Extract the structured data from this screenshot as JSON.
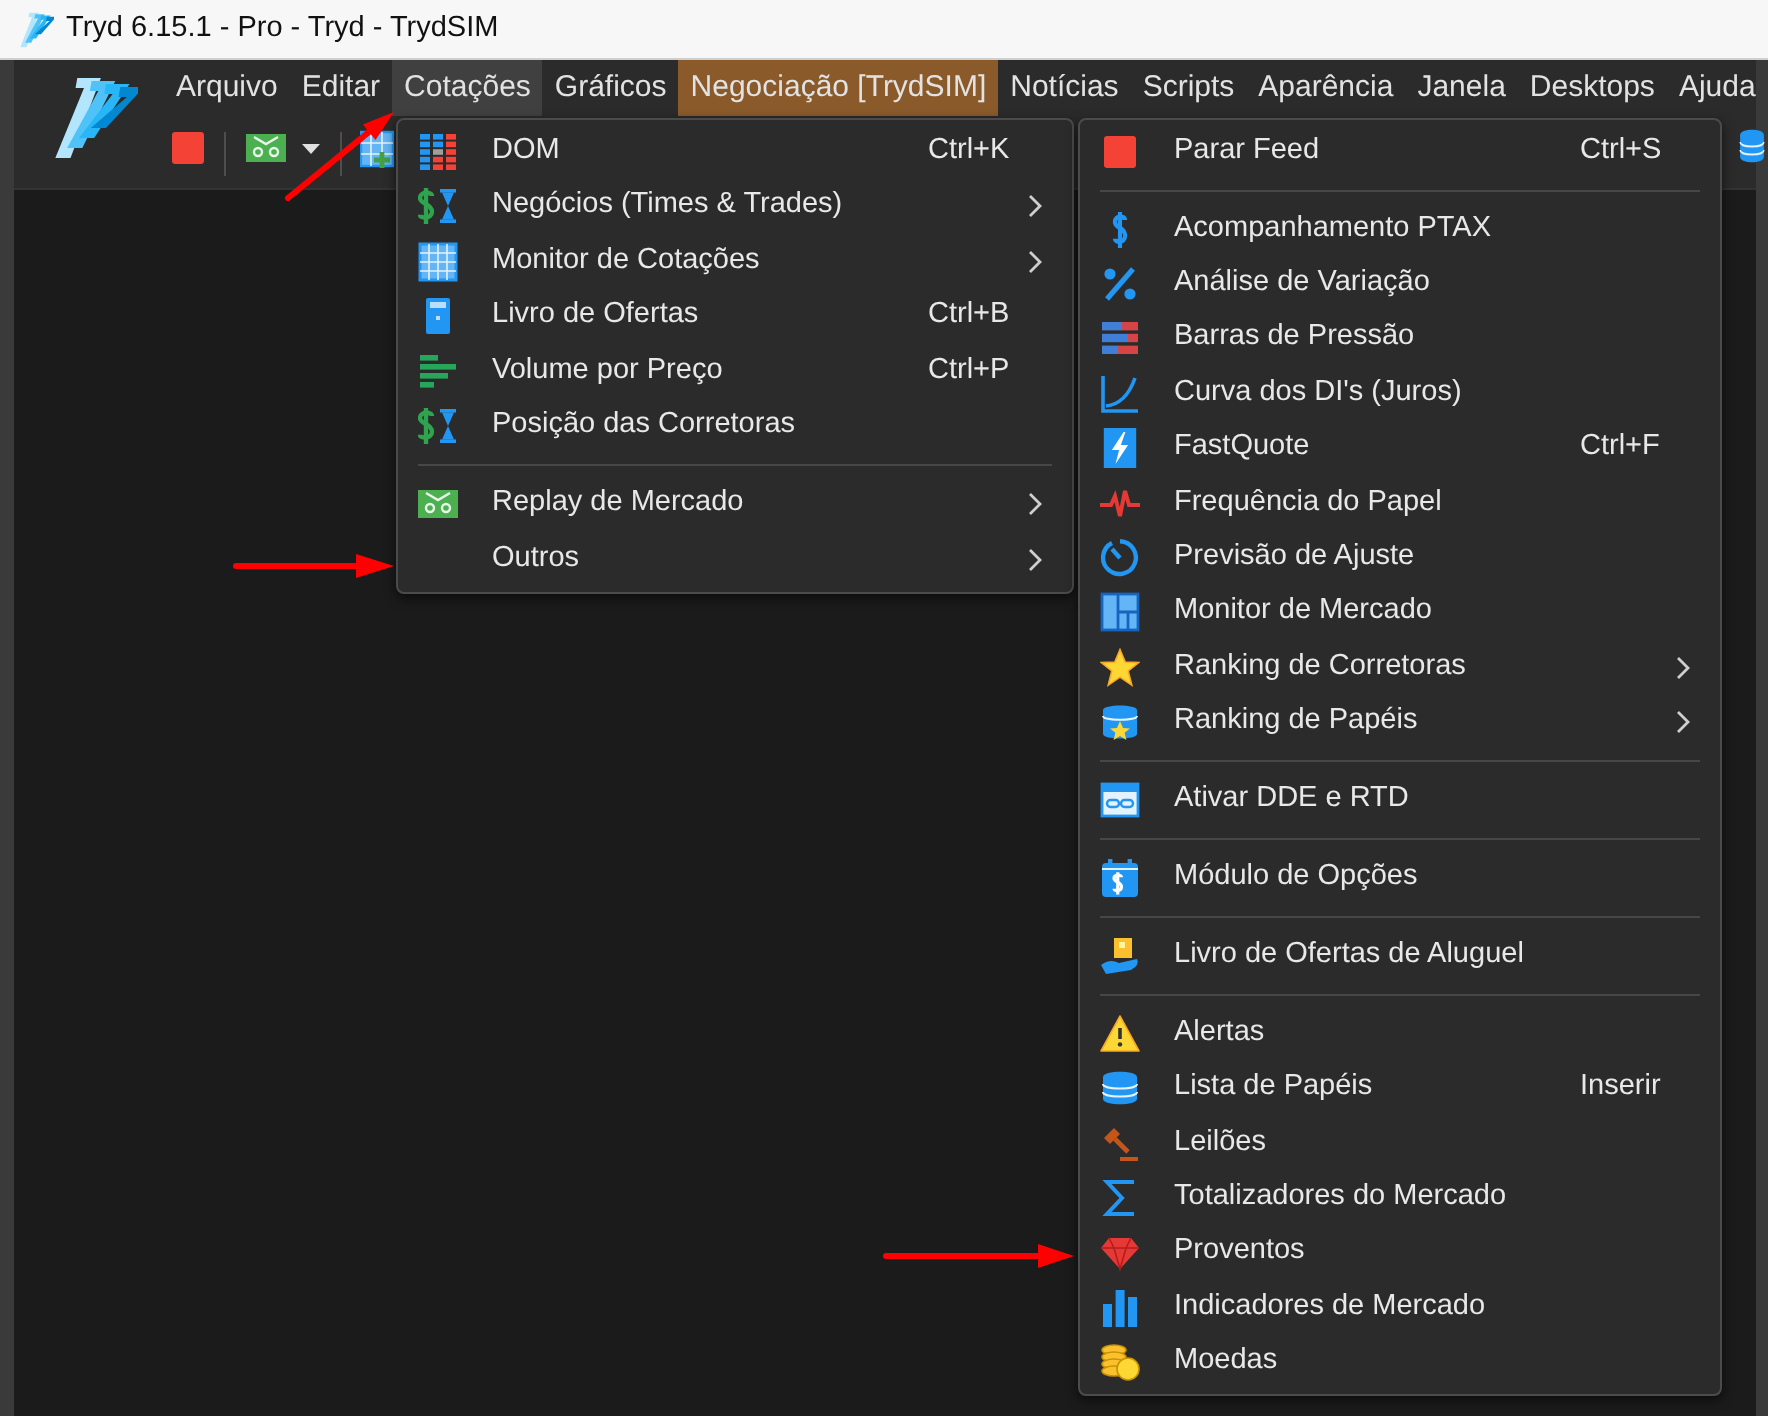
{
  "window": {
    "title": "Tryd 6.15.1 - Pro - Tryd - TrydSIM"
  },
  "menubar": [
    {
      "label": "Arquivo",
      "selected": false
    },
    {
      "label": "Editar",
      "selected": false
    },
    {
      "label": "Cotações",
      "selected": true
    },
    {
      "label": "Gráficos",
      "selected": false
    },
    {
      "label": "Negociação [TrydSIM]",
      "selected": false,
      "color": "#8a5a2b"
    },
    {
      "label": "Notícias",
      "selected": false
    },
    {
      "label": "Scripts",
      "selected": false
    },
    {
      "label": "Aparência",
      "selected": false
    },
    {
      "label": "Janela",
      "selected": false
    },
    {
      "label": "Desktops",
      "selected": false
    },
    {
      "label": "Ajuda",
      "selected": false
    }
  ],
  "cotacoes_menu": {
    "groups": [
      {
        "items": [
          {
            "label": "DOM",
            "shortcut": "Ctrl+K",
            "submenu": false
          },
          {
            "label": "Negócios (Times & Trades)",
            "submenu": true
          },
          {
            "label": "Monitor de Cotações",
            "submenu": true
          },
          {
            "label": "Livro de Ofertas",
            "shortcut": "Ctrl+B",
            "submenu": false
          },
          {
            "label": "Volume por Preço",
            "shortcut": "Ctrl+P",
            "submenu": false
          },
          {
            "label": "Posição das Corretoras",
            "submenu": false
          }
        ]
      },
      {
        "items": [
          {
            "label": "Replay de Mercado",
            "submenu": true
          },
          {
            "label": "Outros",
            "submenu": true
          }
        ]
      }
    ]
  },
  "outros_submenu": {
    "groups": [
      {
        "items": [
          {
            "label": "Parar Feed",
            "shortcut": "Ctrl+S",
            "submenu": false
          }
        ]
      },
      {
        "items": [
          {
            "label": "Acompanhamento PTAX",
            "submenu": false
          },
          {
            "label": "Análise de Variação",
            "submenu": false
          },
          {
            "label": "Barras de Pressão",
            "submenu": false
          },
          {
            "label": "Curva dos DI's (Juros)",
            "submenu": false
          },
          {
            "label": "FastQuote",
            "shortcut": "Ctrl+F",
            "submenu": false
          },
          {
            "label": "Frequência do Papel",
            "submenu": false
          },
          {
            "label": "Previsão de Ajuste",
            "submenu": false
          },
          {
            "label": "Monitor de Mercado",
            "submenu": false
          },
          {
            "label": "Ranking de Corretoras",
            "submenu": true
          },
          {
            "label": "Ranking de Papéis",
            "submenu": true
          }
        ]
      },
      {
        "items": [
          {
            "label": "Ativar DDE e RTD",
            "submenu": false
          }
        ]
      },
      {
        "items": [
          {
            "label": "Módulo de Opções",
            "submenu": false
          }
        ]
      },
      {
        "items": [
          {
            "label": "Livro de Ofertas de Aluguel",
            "submenu": false
          }
        ]
      },
      {
        "items": [
          {
            "label": "Alertas",
            "submenu": false
          },
          {
            "label": "Lista de Papéis",
            "shortcut": "Inserir",
            "submenu": false
          },
          {
            "label": "Leilões",
            "submenu": false
          },
          {
            "label": "Totalizadores do Mercado",
            "submenu": false
          },
          {
            "label": "Proventos",
            "submenu": false
          },
          {
            "label": "Indicadores de Mercado",
            "submenu": false
          },
          {
            "label": "Moedas",
            "submenu": false
          }
        ]
      }
    ]
  }
}
